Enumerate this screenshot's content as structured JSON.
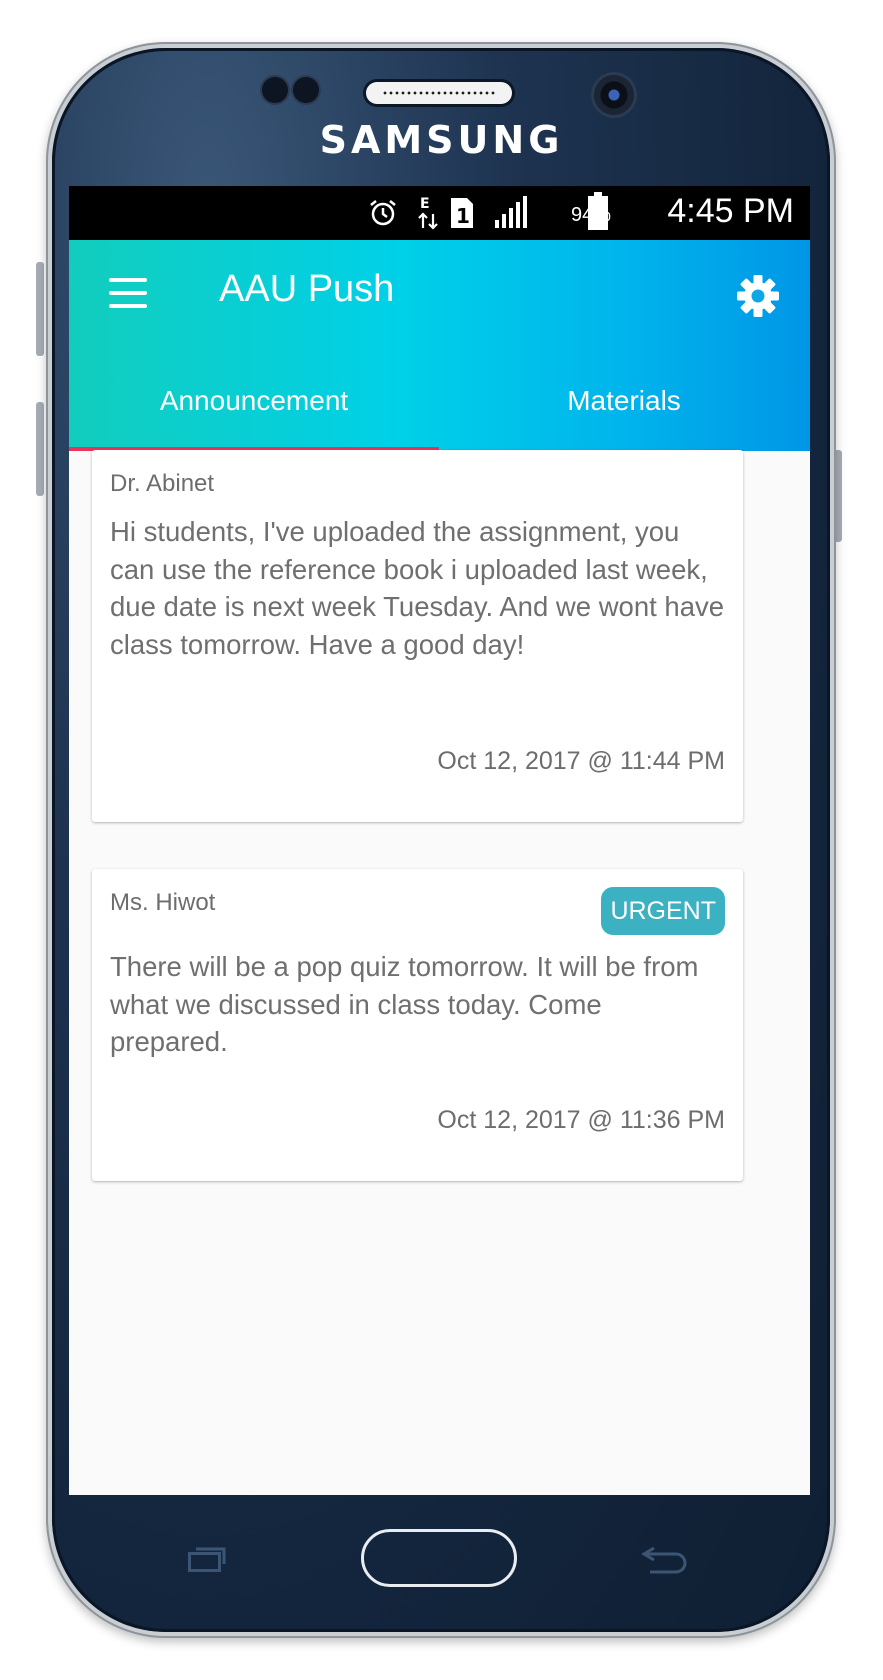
{
  "device": {
    "brand": "SAMSUNG"
  },
  "status_bar": {
    "battery": "94%",
    "time": "4:45 PM"
  },
  "app_bar": {
    "title": "AAU Push",
    "tabs": [
      {
        "label": "Announcement",
        "selected": true
      },
      {
        "label": "Materials",
        "selected": false
      }
    ]
  },
  "colors": {
    "accent": "#e8345a",
    "badge": "#3cb1c2"
  },
  "announcements": [
    {
      "author": "Dr. Abinet",
      "message": "Hi students,  I've uploaded the assignment, you can use the reference book i uploaded last week, due date is next week Tuesday. And we wont have class tomorrow. Have a good day!",
      "timestamp": "Oct 12, 2017 @ 11:44 PM",
      "badge": ""
    },
    {
      "author": "Ms. Hiwot",
      "message": "There will be a pop quiz tomorrow. It will be from what we discussed in class today. Come prepared.",
      "timestamp": "Oct 12, 2017 @ 11:36 PM",
      "badge": "URGENT"
    }
  ]
}
